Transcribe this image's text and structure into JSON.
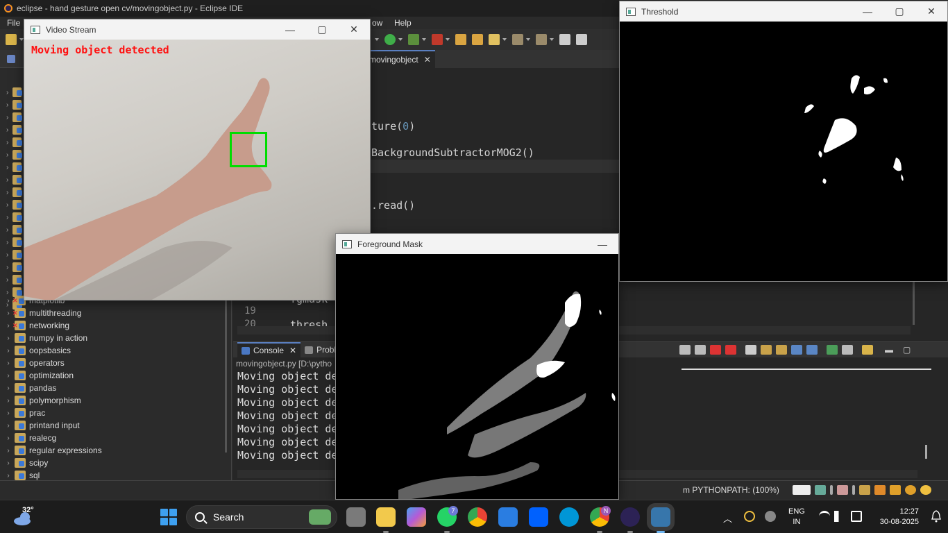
{
  "eclipse": {
    "title": "eclipse - hand gesture open cv/movingobject.py - Eclipse IDE",
    "menu": [
      "File",
      "ow",
      "Help"
    ],
    "project_tab_label": "D",
    "project_tree": [
      {
        "label": "matplotlib",
        "error": true
      },
      {
        "label": "multithreading",
        "error": true
      },
      {
        "label": "networking",
        "error": true
      },
      {
        "label": "numpy in action",
        "error": false
      },
      {
        "label": "oopsbasics",
        "error": false
      },
      {
        "label": "operators",
        "error": false
      },
      {
        "label": "optimization",
        "error": false
      },
      {
        "label": "pandas",
        "error": false
      },
      {
        "label": "polymorphism",
        "error": false
      },
      {
        "label": "prac",
        "error": false
      },
      {
        "label": "printand input",
        "error": false
      },
      {
        "label": "realecg",
        "error": false
      },
      {
        "label": "regular expressions",
        "error": false
      },
      {
        "label": "scipy",
        "error": false
      },
      {
        "label": "sql",
        "error": false
      }
    ],
    "editor": {
      "tab_label": "movingobject",
      "code_fragments": {
        "line1_pre": "ture(",
        "line1_num": "0",
        "line1_post": ")",
        "line2": "BackgroundSubtractorMOG2()",
        "line3": ".read()",
        "fgmask": "fgmask",
        "thresh": "thresh"
      },
      "gutter": [
        "19",
        "20"
      ]
    },
    "console": {
      "tab_console": "Console",
      "tab_problems": "Probl",
      "subtitle": "movingobject.py [D:\\pytho",
      "lines": [
        "Moving object de",
        "Moving object de",
        "Moving object de",
        "Moving object de",
        "Moving object de",
        "Moving object de",
        "Moving object de"
      ]
    },
    "status_text": "m PYTHONPATH: (100%)"
  },
  "windows": {
    "video_stream": {
      "title": "Video Stream",
      "overlay_text": "Moving object detected"
    },
    "threshold": {
      "title": "Threshold"
    },
    "foreground_mask": {
      "title": "Foreground Mask"
    }
  },
  "taskbar": {
    "temperature": "32°",
    "search_label": "Search",
    "whatsapp_badge": "7",
    "chrome_badge": "N",
    "lang_line1": "ENG",
    "lang_line2": "IN",
    "time": "12:27",
    "date": "30-08-2025"
  }
}
